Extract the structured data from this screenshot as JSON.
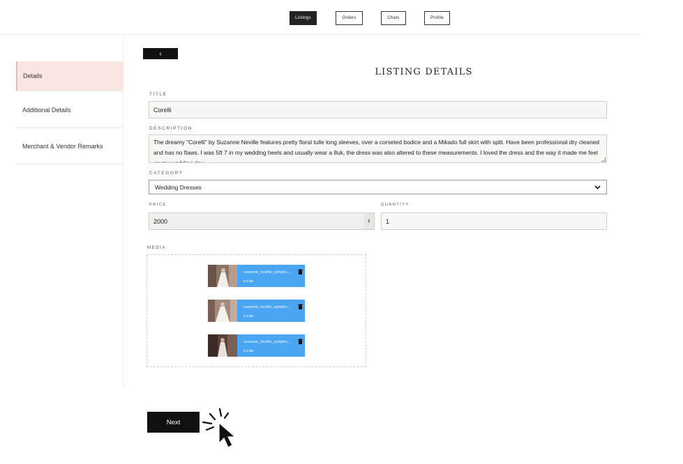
{
  "nav": {
    "items": [
      "Listings",
      "Orders",
      "Chats",
      "Profile"
    ],
    "active": "Listings"
  },
  "sidebar": {
    "items": [
      {
        "label": "Details",
        "active": true
      },
      {
        "label": "Additional Details",
        "active": false
      },
      {
        "label": "Merchant & Vendor Remarks",
        "active": false
      }
    ]
  },
  "page": {
    "back_symbol": "‹",
    "title": "LISTING DETAILS"
  },
  "form": {
    "title_label": "TITLE",
    "title_value": "Corelli",
    "description_label": "DESCRIPTION",
    "description_value": "The dreamy \"Corelli\" by Suzanne Neville features pretty floral tulle long sleeves, over a corseted bodice and a Mikado full skirt with split.  Have been professional dry cleaned and has no flaws. I was 5ft 7 in my wedding heels and usually wear a 8uk, the dress was also altered to these measurements. I loved the dress and the way it made me feel on my wedding day.",
    "category_label": "CATEGORY",
    "category_value": "Wedding Dresses",
    "price_label": "PRICE",
    "price_value": "2000",
    "currency_symbol": "£",
    "quantity_label": "QUANTITY",
    "quantity_value": "1"
  },
  "media": {
    "label": "MEDIA",
    "files": [
      {
        "name": "suzanne_neville_sympho...",
        "size": "0.4 MB"
      },
      {
        "name": "suzanne_neville_sympho...",
        "size": "0.4 MB"
      },
      {
        "name": "suzanne_neville_sympho...",
        "size": "0.3 MB"
      }
    ]
  },
  "actions": {
    "next_label": "Next"
  },
  "colors": {
    "accent_active": "#f8e6e3",
    "media_blue": "#4aa5f2",
    "button_dark": "#111111"
  }
}
